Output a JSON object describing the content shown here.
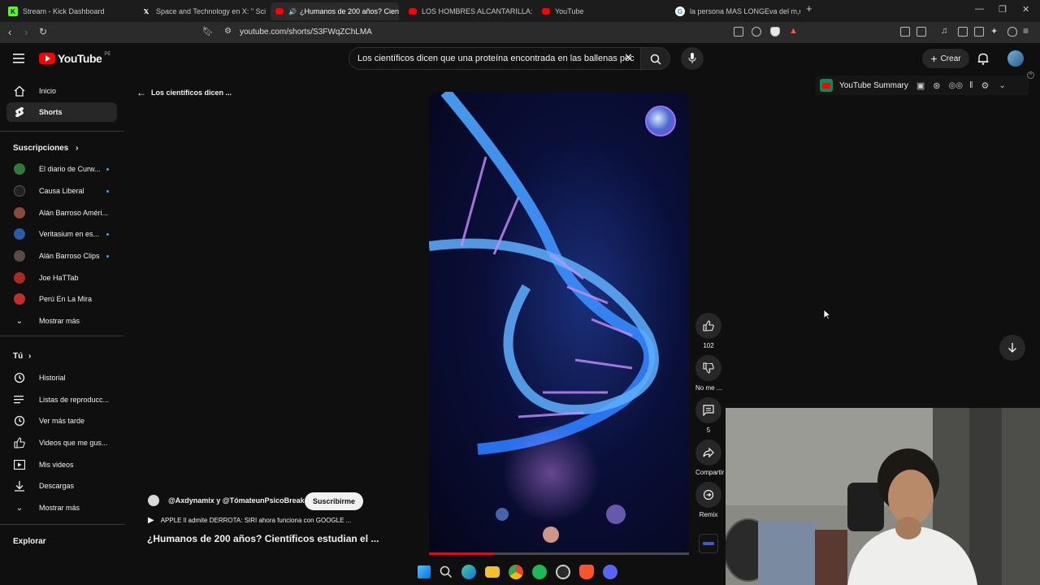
{
  "browser": {
    "tabs": [
      {
        "title": "Stream - Kick Dashboard",
        "icon": "kick-icon"
      },
      {
        "title": "Space and Technology en X: \" Sci",
        "icon": "x-icon"
      },
      {
        "title": "¿Humanos de 200 años? Cien",
        "icon": "youtube-icon",
        "active": true
      },
      {
        "title": "LOS HOMBRES ALCANTARILLA: el tra",
        "icon": "youtube-icon"
      },
      {
        "title": "YouTube",
        "icon": "youtube-icon"
      },
      {
        "title": "la persona MAS LONGEva del m,und",
        "icon": "google-icon"
      }
    ],
    "url": "youtube.com/shorts/S3FWqZChLMA"
  },
  "header": {
    "logo": "YouTube",
    "region": "PE",
    "search_value": "Los científicos dicen que una proteína encontrada en las ballenas poc",
    "create_label": "Crear"
  },
  "sidebar": {
    "main": [
      {
        "label": "Inicio",
        "icon": "home-icon"
      },
      {
        "label": "Shorts",
        "icon": "shorts-icon",
        "selected": true
      }
    ],
    "subs_title": "Suscripciones",
    "subscriptions": [
      {
        "label": "El diario de Curw...",
        "new": true,
        "color": "#2d7a3a"
      },
      {
        "label": "Causa Liberal",
        "new": true,
        "color": "#222222"
      },
      {
        "label": "Alán Barroso Améri...",
        "new": false,
        "color": "#8a4a3a"
      },
      {
        "label": "Veritasium en es...",
        "new": true,
        "color": "#2a5aa8"
      },
      {
        "label": "Alán Barroso Clips",
        "new": true,
        "color": "#5a4a48"
      },
      {
        "label": "Joe HaTTab",
        "new": false,
        "color": "#a82a20"
      },
      {
        "label": "Perú En La Mira",
        "new": false,
        "color": "#c0302a"
      }
    ],
    "subs_more": "Mostrar más",
    "you_title": "Tú",
    "you_items": [
      {
        "label": "Historial",
        "icon": "history-icon"
      },
      {
        "label": "Listas de reproducc...",
        "icon": "playlist-icon"
      },
      {
        "label": "Ver más tarde",
        "icon": "clock-icon"
      },
      {
        "label": "Videos que me gus...",
        "icon": "like-icon"
      },
      {
        "label": "Mis videos",
        "icon": "video-icon"
      },
      {
        "label": "Descargas",
        "icon": "download-icon"
      }
    ],
    "you_more": "Mostrar más",
    "explore_title": "Explorar"
  },
  "shorts": {
    "back_title": "Los científicos dicen ...",
    "channel": "@Axdynamix y @TómateunPsicoBreak",
    "subscribe_label": "Suscribirme",
    "related_video": "APPLE ll admite DERROTA: SIRI ahora funciona con GOOGLE ...",
    "title": "¿Humanos de 200 años? Científicos estudian el ...",
    "likes": "102",
    "dislike_label": "No me ...",
    "comments": "5",
    "share_label": "Compartir",
    "remix_label": "Remix",
    "progress": 0.25
  },
  "extension": {
    "label": "YouTube Summary"
  }
}
